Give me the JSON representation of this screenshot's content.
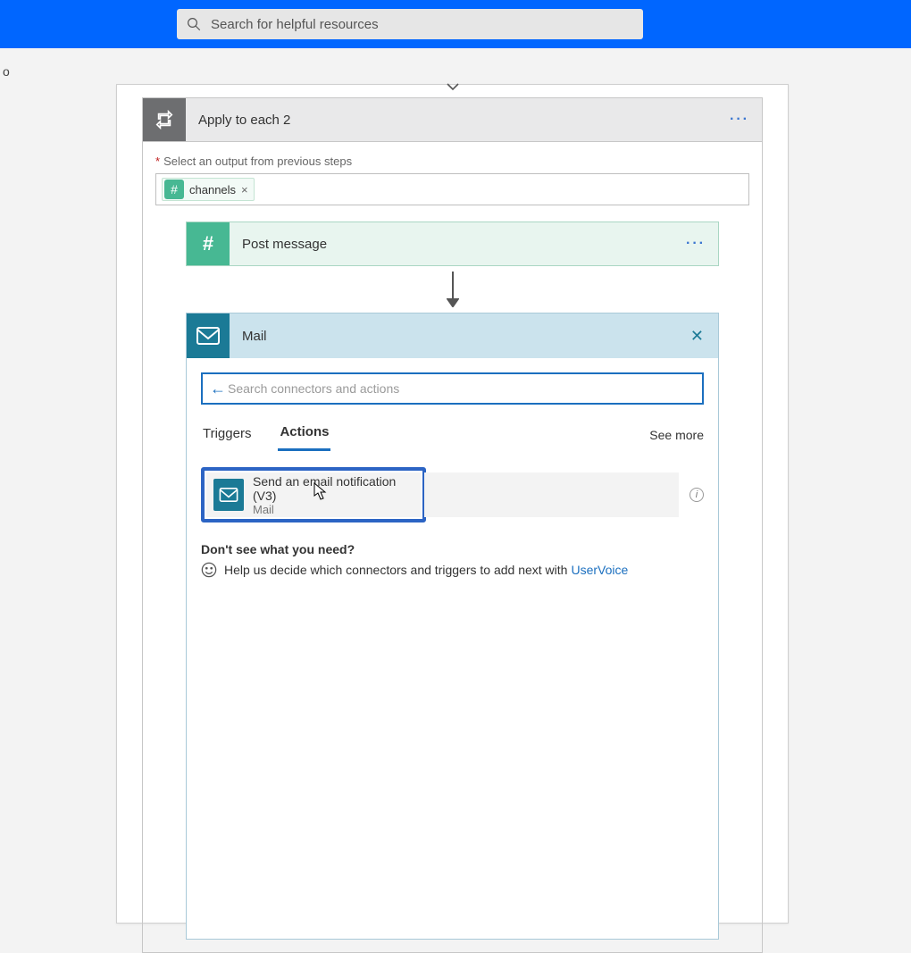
{
  "topbar": {
    "search_placeholder": "Search for helpful resources"
  },
  "foreach": {
    "title": "Apply to each 2",
    "required_label": "Select an output from previous steps",
    "token_label": "channels"
  },
  "post_message": {
    "title": "Post message"
  },
  "mail": {
    "title": "Mail",
    "search_placeholder": "Search connectors and actions",
    "tabs": {
      "triggers": "Triggers",
      "actions": "Actions"
    },
    "see_more": "See more",
    "action": {
      "title": "Send an email notification (V3)",
      "connector": "Mail"
    },
    "footer": {
      "need_text": "Don't see what you need?",
      "help_text": "Help us decide which connectors and triggers to add next with",
      "link_text": "UserVoice"
    }
  }
}
